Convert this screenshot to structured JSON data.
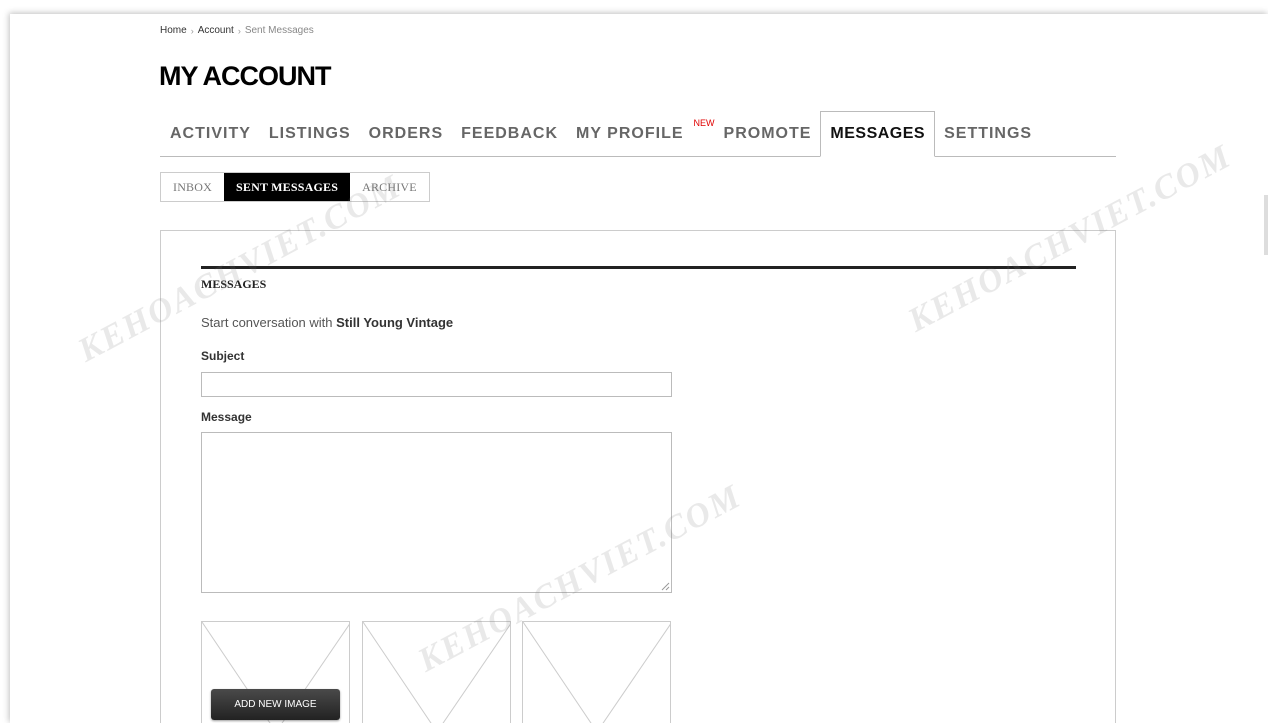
{
  "breadcrumb": {
    "items": [
      "Home",
      "Account",
      "Sent Messages"
    ],
    "separator": "›"
  },
  "page_title": "MY ACCOUNT",
  "main_tabs": [
    {
      "label": "ACTIVITY"
    },
    {
      "label": "LISTINGS"
    },
    {
      "label": "ORDERS"
    },
    {
      "label": "FEEDBACK"
    },
    {
      "label": "MY PROFILE",
      "badge": "NEW"
    },
    {
      "label": "PROMOTE"
    },
    {
      "label": "MESSAGES",
      "active": true
    },
    {
      "label": "SETTINGS"
    }
  ],
  "sub_tabs": [
    {
      "label": "INBOX"
    },
    {
      "label": "SENT MESSAGES",
      "active": true
    },
    {
      "label": "ARCHIVE"
    }
  ],
  "compose": {
    "heading": "MESSAGES",
    "intro_prefix": "Start conversation with",
    "recipient": "Still Young Vintage",
    "subject_label": "Subject",
    "subject_value": "",
    "message_label": "Message",
    "message_value": "",
    "add_image_label": "ADD NEW IMAGE"
  },
  "watermark_text": "KEHOACHVIET.COM",
  "colors": {
    "badge": "#e00000",
    "active_subtab_bg": "#000000",
    "button_bg": "#333333"
  }
}
